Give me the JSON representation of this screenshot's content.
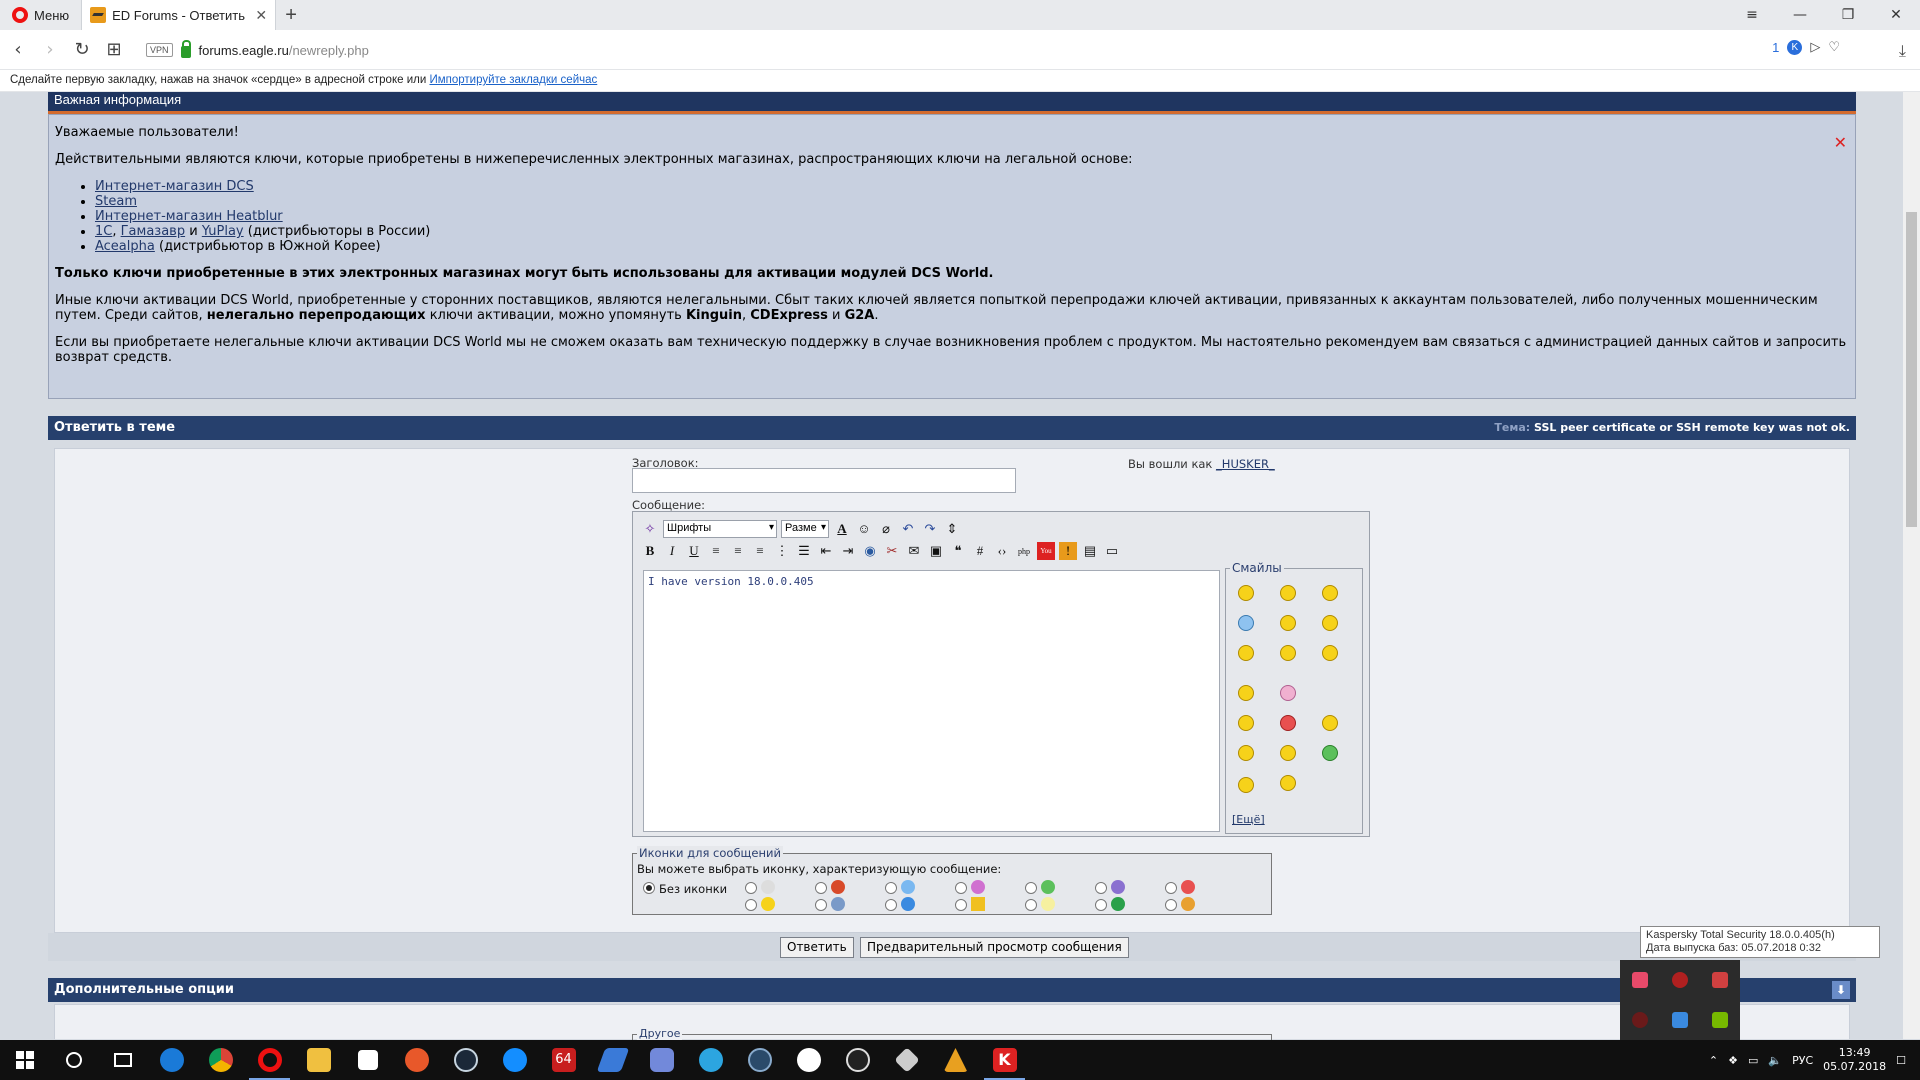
{
  "browser": {
    "menu_label": "Меню",
    "tab_title": "ED Forums - Ответить в т",
    "url_host": "forums.eagle.ru",
    "url_path": "/newreply.php",
    "vpn_label": "VPN",
    "kasp_count": "1",
    "bookmark_hint": "Сделайте первую закладку, нажав на значок «сердце» в адресной строке или ",
    "bookmark_link": "Импортируйте закладки сейчас"
  },
  "notice": {
    "title": "Важная информация",
    "greeting": "Уважаемые пользователи!",
    "intro": "Действительными являются ключи, которые приобретены в нижеперечисленных электронных магазинах, распространяющих ключи на легальной основе:",
    "stores": [
      {
        "link": "Интернет-магазин DCS",
        "tail": ""
      },
      {
        "link": "Steam",
        "tail": ""
      },
      {
        "link": "Интернет-магазин Heatblur",
        "tail": ""
      },
      {
        "link": "1С",
        "mid1": ", ",
        "link2": "Гамазавр",
        "mid2": " и ",
        "link3": "YuPlay",
        "tail": " (дистрибьюторы в России)"
      },
      {
        "link": "Acealpha",
        "tail": " (дистрибьютор в Южной Корее)"
      }
    ],
    "bold_line": "Только ключи приобретенные в этих электронных магазинах могут быть использованы для активации модулей DCS World.",
    "p3_a": "Иные ключи активации DCS World, приобретенные у сторонних поставщиков, являются нелегальными. Сбыт таких ключей является попыткой перепродажи ключей активации, привязанных к аккаунтам пользователей, либо полученных мошенническим путем. Среди сайтов, ",
    "p3_b": "нелегально перепродающих",
    "p3_c": " ключи активации, можно упомянуть ",
    "p3_d": "Kinguin",
    "p3_e": ", ",
    "p3_f": "CDExpress",
    "p3_g": " и ",
    "p3_h": "G2A",
    "p3_i": ".",
    "p4": "Если вы приобретаете нелегальные ключи активации DCS World мы не сможем оказать вам техническую поддержку в случае возникновения проблем с продуктом. Мы настоятельно рекомендуем вам связаться с администрацией данных сайтов и запросить возврат средств."
  },
  "reply": {
    "section_title": "Ответить в теме",
    "topic_label": "Тема:",
    "topic_value": "SSL peer certificate or SSH remote key was not ok.",
    "title_label": "Заголовок:",
    "logged_in": "Вы вошли как ",
    "username": "_HUSKER_",
    "message_label": "Сообщение:",
    "font_select": "Шрифты",
    "size_select": "Разме",
    "message_text": "I have version 18.0.0.405",
    "smilies_title": "Смайлы",
    "more_smilies": "[Ещё]",
    "icons_legend": "Иконки для сообщений",
    "icons_hint": "Вы можете выбрать иконку, характеризующую сообщение:",
    "no_icon": "Без иконки",
    "submit_label": "Ответить",
    "preview_label": "Предварительный просмотр сообщения"
  },
  "extra": {
    "title": "Дополнительные опции",
    "other_legend": "Другое"
  },
  "tooltip": {
    "line1": "Kaspersky Total Security 18.0.0.405(h)",
    "line2": "Дата выпуска баз: 05.07.2018 0:32"
  },
  "taskbar": {
    "lang": "РУС",
    "time": "13:49",
    "date": "05.07.2018",
    "badge_64": "64"
  }
}
